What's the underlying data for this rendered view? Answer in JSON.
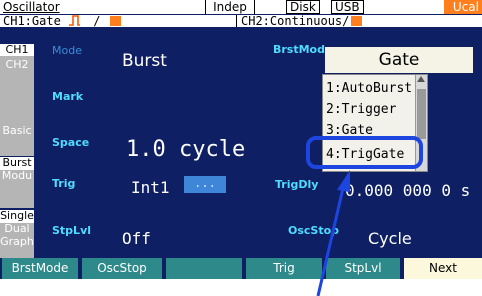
{
  "status": {
    "title": "Oscillator",
    "indep": "Indep",
    "disk": "Disk",
    "usb": "USB",
    "ucal": "Ucal"
  },
  "channels": {
    "ch1_label": "CH1:Gate",
    "ch1_sep": "/",
    "ch2_label": "CH2:Continuous/"
  },
  "sidebar": {
    "ch1": "CH1",
    "ch2": "CH2",
    "basic": "Basic",
    "burst": "Burst",
    "modu": "Modu",
    "single": "Single",
    "dual": "Dual",
    "graph": "Graph"
  },
  "fields": {
    "mode_label": "Mode",
    "mode_value": "Burst",
    "mark_label": "Mark",
    "space_label": "Space",
    "space_value": "1.0 cycle",
    "trig_label": "Trig",
    "trig_value": "Int1",
    "trig_button": "...",
    "stplvl_label": "StpLvl",
    "stplvl_value": "Off",
    "brstmode_label": "BrstMode",
    "brstmode_value": "Gate",
    "trigdly_label": "TrigDly",
    "trigdly_value": "0.000 000 0 s",
    "oscstop_label": "OscStop",
    "oscstop_value": "Cycle"
  },
  "dropdown": {
    "options": [
      "1:AutoBurst",
      "2:Trigger",
      "3:Gate",
      "4:TrigGate"
    ],
    "highlighted": "4:TrigGate"
  },
  "softkeys": [
    "BrstMode",
    "OscStop",
    "",
    "Trig",
    "StpLvl",
    "Next"
  ],
  "colors": {
    "background": "#0e1f63",
    "accent_orange": "#ff7f1e",
    "label_cyan": "#4fdcff",
    "softkey_teal": "#2e8a8a",
    "annotation_blue": "#1d45e0"
  }
}
